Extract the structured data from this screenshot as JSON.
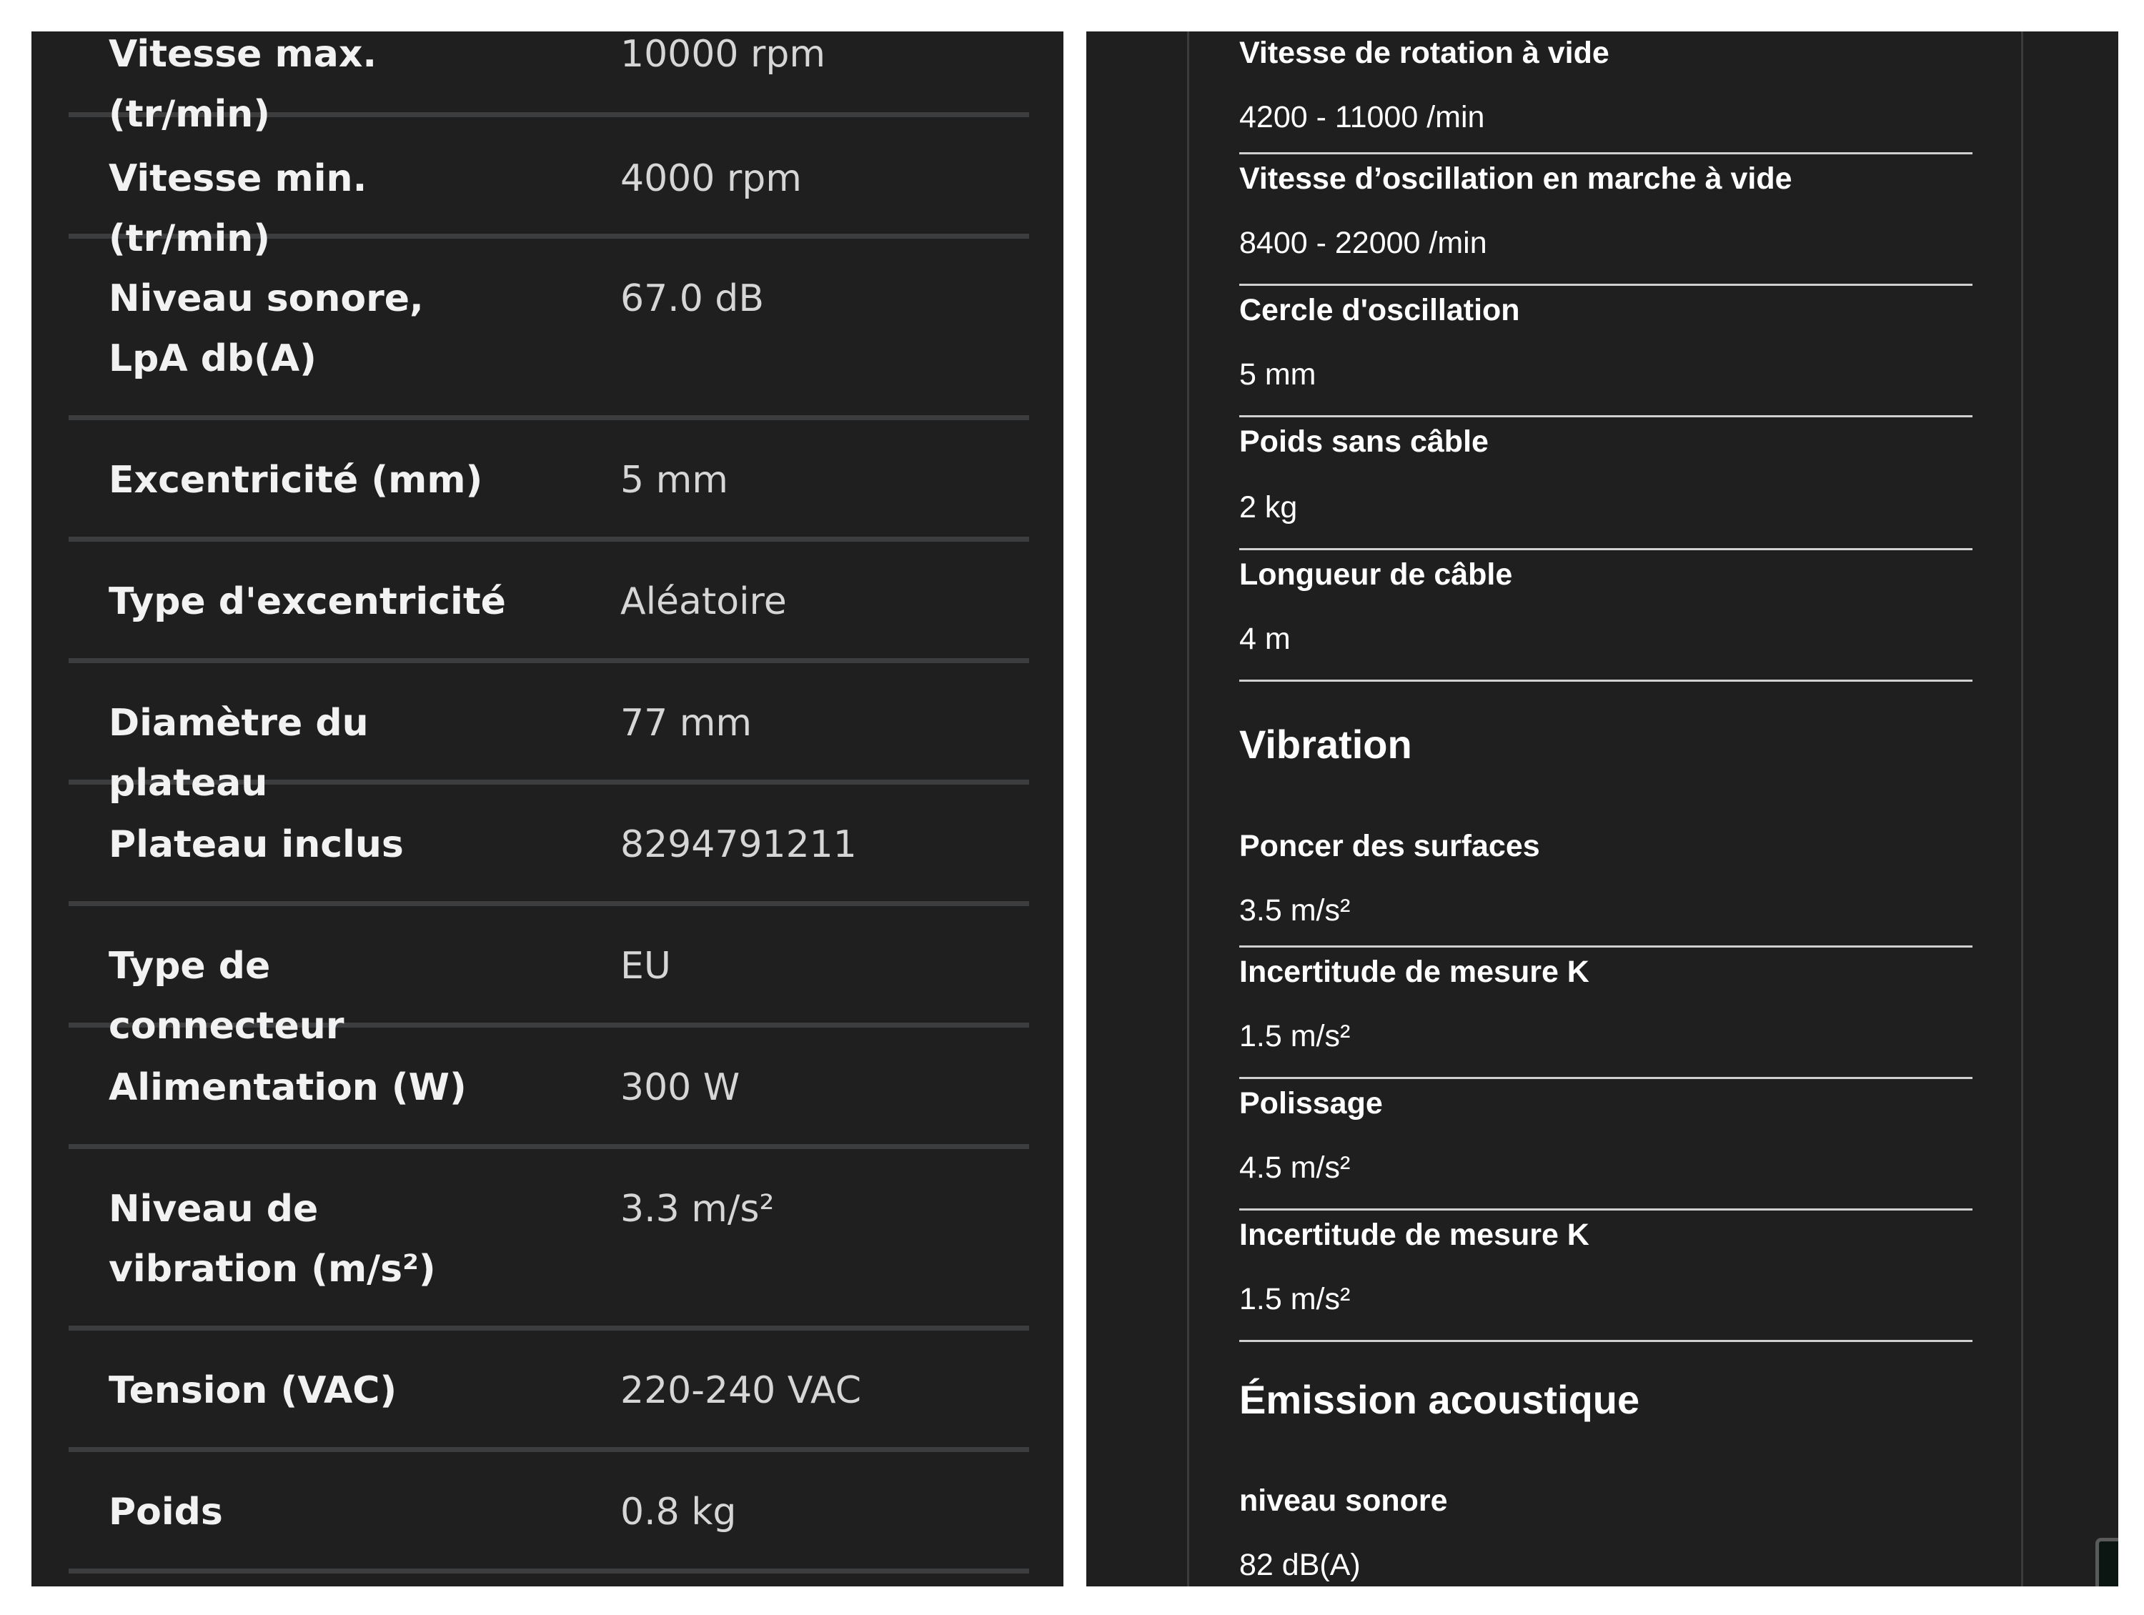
{
  "left_specs": [
    {
      "label": "Vitesse max. (tr/min)",
      "value": "10000 rpm"
    },
    {
      "label": "Vitesse min. (tr/min)",
      "value": "4000 rpm"
    },
    {
      "label": "Niveau sonore, LpA db(A)",
      "value": "67.0 dB"
    },
    {
      "label": "Excentricité (mm)",
      "value": "5 mm"
    },
    {
      "label": "Type d'excentricité",
      "value": "Aléatoire"
    },
    {
      "label": "Diamètre du plateau",
      "value": "77 mm"
    },
    {
      "label": "Plateau inclus",
      "value": "8294791211"
    },
    {
      "label": "Type de connecteur",
      "value": "EU"
    },
    {
      "label": "Alimentation (W)",
      "value": "300 W"
    },
    {
      "label": "Niveau de vibration (m/s²)",
      "value": "3.3 m/s²"
    },
    {
      "label": "Tension (VAC)",
      "value": "220-240 VAC"
    },
    {
      "label": "Poids",
      "value": "0.8 kg"
    }
  ],
  "right_specs": [
    {
      "label": "Vitesse de rotation à vide",
      "value": "4200 - 11000 /min"
    },
    {
      "label": "Vitesse d’oscillation en marche à vide",
      "value": "8400 - 22000 /min"
    },
    {
      "label": "Cercle d'oscillation",
      "value": "5 mm"
    },
    {
      "label": "Poids sans câble",
      "value": "2 kg"
    },
    {
      "label": "Longueur de câble",
      "value": "4 m"
    }
  ],
  "vibration": {
    "heading": "Vibration",
    "items": [
      {
        "label": "Poncer des surfaces",
        "value": "3.5 m/s²"
      },
      {
        "label": "Incertitude de mesure K",
        "value": "1.5 m/s²"
      },
      {
        "label": "Polissage",
        "value": "4.5 m/s²"
      },
      {
        "label": "Incertitude de mesure K",
        "value": "1.5 m/s²"
      }
    ]
  },
  "acoustic": {
    "heading": "Émission acoustique",
    "items": [
      {
        "label": "niveau sonore",
        "value": "82 dB(A)"
      }
    ]
  },
  "scroll_top": {
    "icon": "chevron-up-icon"
  }
}
